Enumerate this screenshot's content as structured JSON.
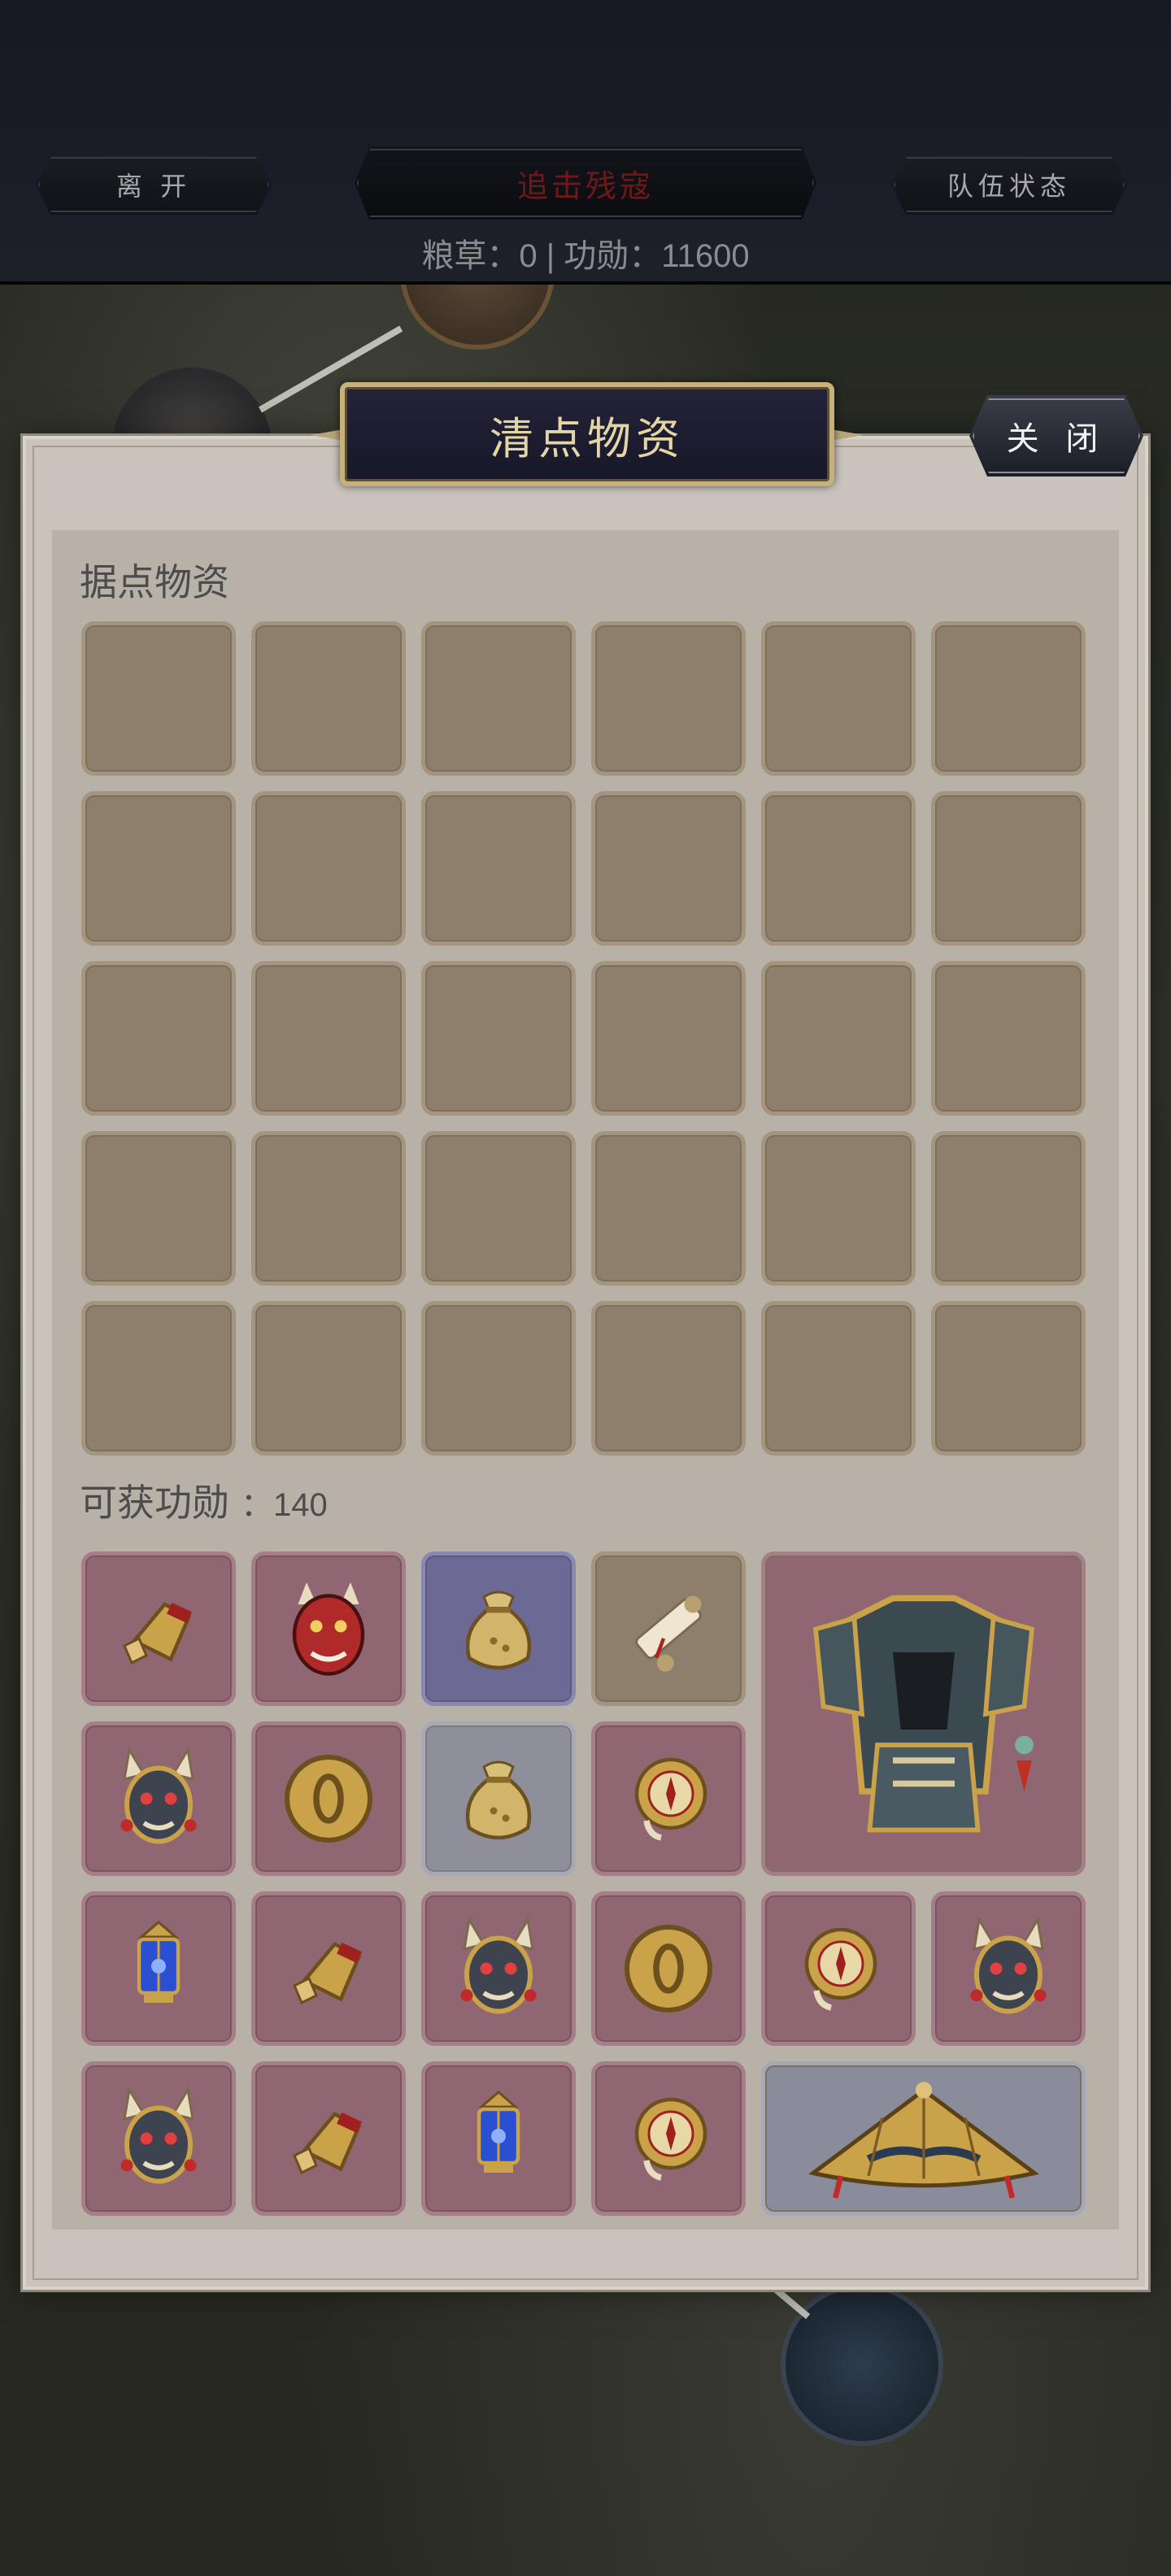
{
  "topbar": {
    "leave_label": "离 开",
    "mission_label": "追击残寇",
    "team_label": "队伍状态",
    "resources": "粮草：0 | 功勋：11600"
  },
  "dialog": {
    "title": "清点物资",
    "close_label": "关 闭",
    "stronghold_label": "据点物资",
    "merit_label": "可获功勋",
    "merit_value": "：140"
  },
  "stronghold_slots": 30,
  "rewards": [
    {
      "icon": "golden-gauntlet-icon",
      "rarity": "purple"
    },
    {
      "icon": "red-oni-mask-icon",
      "rarity": "purple"
    },
    {
      "icon": "gold-pouch-icon",
      "rarity": "blue"
    },
    {
      "icon": "scroll-icon",
      "rarity": "brown"
    },
    {
      "icon": "samurai-armor-icon",
      "rarity": "purple",
      "size": "2x2"
    },
    {
      "icon": "horned-oni-mask-icon",
      "rarity": "purple"
    },
    {
      "icon": "gold-coin-icon",
      "rarity": "purple"
    },
    {
      "icon": "gold-pouch-icon",
      "rarity": "gray"
    },
    {
      "icon": "compass-icon",
      "rarity": "purple"
    },
    {
      "icon": "blue-lantern-icon",
      "rarity": "purple"
    },
    {
      "icon": "golden-gauntlet-icon",
      "rarity": "purple"
    },
    {
      "icon": "horned-oni-mask-icon",
      "rarity": "purple"
    },
    {
      "icon": "gold-coin-icon",
      "rarity": "purple"
    },
    {
      "icon": "compass-icon",
      "rarity": "purple"
    },
    {
      "icon": "horned-oni-mask-icon",
      "rarity": "purple"
    },
    {
      "icon": "horned-oni-mask-icon",
      "rarity": "purple"
    },
    {
      "icon": "golden-gauntlet-icon",
      "rarity": "purple"
    },
    {
      "icon": "blue-lantern-icon",
      "rarity": "purple"
    },
    {
      "icon": "compass-icon",
      "rarity": "purple"
    },
    {
      "icon": "straw-hat-icon",
      "rarity": "gray",
      "size": "2x1"
    }
  ],
  "colors": {
    "panel": "#c9c3bc",
    "slot_brown": "#8e7f6d",
    "slot_purple": "#8f6672",
    "slot_blue": "#6c6a94",
    "slot_gray": "#8e8f9a",
    "title_gold": "#e4d5a6",
    "mission_red": "#6e1818"
  }
}
